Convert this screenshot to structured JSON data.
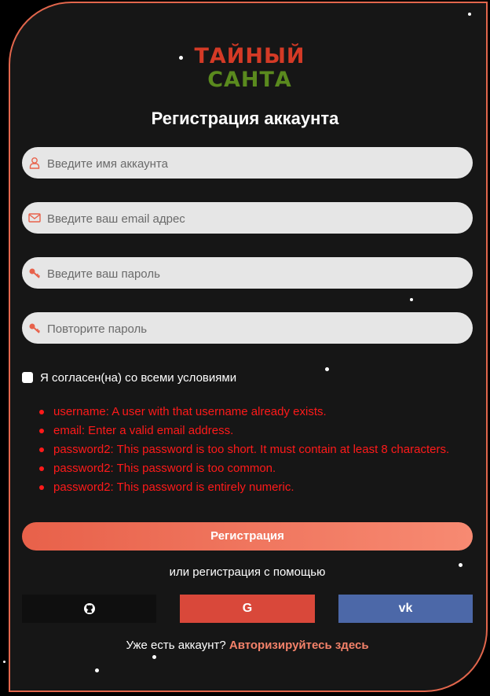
{
  "logo": {
    "line1": "ТАЙНЫЙ",
    "line2": "САНТА"
  },
  "title": "Регистрация аккаунта",
  "fields": {
    "username": {
      "placeholder": "Введите имя аккаунта",
      "icon": "user-icon"
    },
    "email": {
      "placeholder": "Введите ваш email адрес",
      "icon": "envelope-icon"
    },
    "password": {
      "placeholder": "Введите ваш пароль",
      "icon": "key-icon"
    },
    "password2": {
      "placeholder": "Повторите пароль",
      "icon": "key-icon"
    }
  },
  "agree_label": "Я согласен(на) со всеми условиями",
  "errors": [
    "username: A user with that username already exists.",
    "email: Enter a valid email address.",
    "password2: This password is too short. It must contain at least 8 characters.",
    "password2: This password is too common.",
    "password2: This password is entirely numeric."
  ],
  "submit_label": "Регистрация",
  "alt_text": "или регистрация с помощью",
  "social": {
    "github": {
      "icon": "github-icon",
      "glyph": "◉"
    },
    "google": {
      "icon": "google-icon",
      "glyph": "G"
    },
    "vk": {
      "icon": "vk-icon",
      "glyph": "vk"
    }
  },
  "login": {
    "question": "Уже есть аккаунт?",
    "link": "Авторизируйтесь здесь"
  },
  "colors": {
    "accent": "#e8614a",
    "error": "#ff1a1a",
    "card_bg": "#161616",
    "google": "#d9483a",
    "vk": "#4c68a8"
  }
}
